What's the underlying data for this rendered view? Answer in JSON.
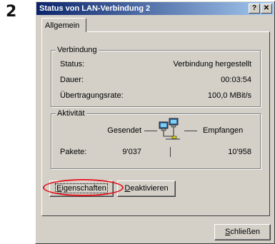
{
  "step_number": "2",
  "window": {
    "title": "Status von LAN-Verbindung 2",
    "help_label": "?",
    "close_label": "✕"
  },
  "tab": {
    "label": "Allgemein"
  },
  "connection": {
    "legend": "Verbindung",
    "status_label": "Status:",
    "status_value": "Verbindung hergestellt",
    "duration_label": "Dauer:",
    "duration_value": "00:03:54",
    "speed_label": "Übertragungsrate:",
    "speed_value": "100,0 MBit/s"
  },
  "activity": {
    "legend": "Aktivität",
    "sent_label": "Gesendet",
    "received_label": "Empfangen",
    "packets_label": "Pakete:",
    "packets_sent": "9'037",
    "packets_received": "10'958",
    "icon": "network-activity-icon"
  },
  "buttons": {
    "properties_first": "E",
    "properties_rest": "igenschaften",
    "deactivate_first": "D",
    "deactivate_rest": "eaktivieren",
    "close_first": "S",
    "close_rest": "chließen"
  },
  "colors": {
    "title_start": "#0a246a",
    "title_end": "#a6caf0",
    "dialog_bg": "#d4d0c8",
    "highlight_ring": "#e0141e"
  }
}
